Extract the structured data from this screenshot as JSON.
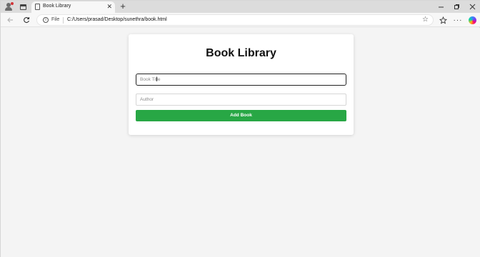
{
  "browser": {
    "tab_title": "Book Library",
    "tab_close": "✕",
    "new_tab": "+",
    "file_label": "File",
    "url": "C:/Users/prasad/Desktop/sunethra/book.html"
  },
  "page": {
    "title": "Book Library",
    "title_placeholder": "Book Title",
    "title_value": "",
    "author_placeholder": "Author",
    "author_value": "",
    "add_button_label": "Add Book"
  },
  "icons": {
    "profile": "profile-icon",
    "tab_actions": "tab-actions-icon",
    "page": "page-icon",
    "back": "back-arrow-icon",
    "refresh": "refresh-icon",
    "info": "info-icon",
    "star": "star-icon",
    "favorites": "favorites-icon",
    "more": "more-icon",
    "copilot": "copilot-icon"
  },
  "colors": {
    "accent_button": "#28a745",
    "page_background": "#f4f4f4",
    "card_background": "#ffffff"
  }
}
